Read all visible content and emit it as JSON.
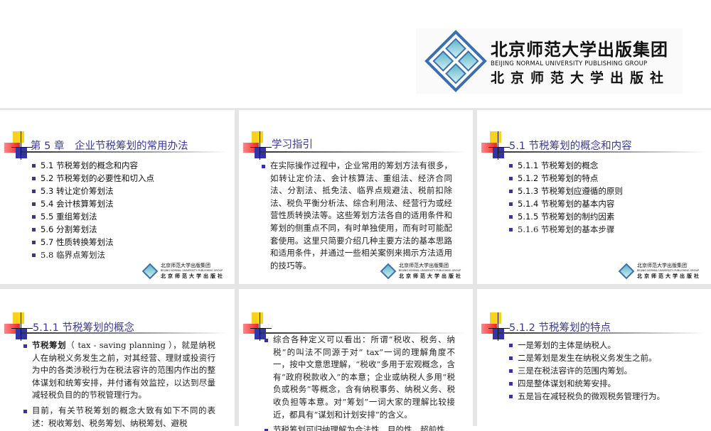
{
  "logo": {
    "cn": "北京师范大学出版集团",
    "en": "BEIJING NORMAL UNIVERSITY PUBLISHING GROUP",
    "cn2": "北京师范大学出版社"
  },
  "slides": [
    {
      "title": "第 5 章　企业节税筹划的常用办法",
      "items": [
        "5.1  节税筹划的概念和内容",
        "5.2  节税筹划的必要性和切入点",
        "5.3  转让定价筹划法",
        "5.4  会计核算筹划法",
        "5.5  重组筹划法",
        "5.6  分割筹划法",
        "5.7  性质转换筹划法",
        "5.8  临界点筹划法"
      ]
    },
    {
      "title": "学习指引",
      "items": [
        "在实际操作过程中，企业常用的筹划方法有很多，如转让定价法、会计核算法、重组法、经济合同法、分割法、抵免法、临界点规避法、税前扣除法、税负平衡分析法、综合利用法、经营行为或经营性质转换法等。这些筹划方法各自的适用条件和筹划的侧重点不同，有时单独使用，而有时可能配套使用。这里只简要介绍几种主要方法的基本思路和适用条件，并通过一些相关案例来揭示方法适用的技巧等。"
      ]
    },
    {
      "title": "5.1  节税筹划的概念和内容",
      "items": [
        "5.1.1  节税筹划的概念",
        "5.1.2  节税筹划的特点",
        "5.1.3  节税筹划应遵循的原则",
        "5.1.4  节税筹划的基本内容",
        "5.1.5  节税筹划的制约因素",
        "5.1.6  节税筹划的基本步骤"
      ]
    },
    {
      "title": "5.1.1  节税筹划的概念",
      "bold": "节税筹划",
      "items": [
        "（ tax - saving  planning ），就是纳税人在纳税义务发生之前，对其经营、理财或投资行为中的各类涉税行为在税法容许的范围内作出的整体谋划和统筹安排，并付诸有效监控，以达到尽量减轻税负目的的节税管理行为。",
        "目前，有关节税筹划的概念大致有如下不同的表述：税收筹划、税务筹划、纳税筹划、避税"
      ]
    },
    {
      "title": "",
      "items": [
        "综合各种定义可以看出：所谓“税收、税务、纳税”的叫法不同源于对“ tax”一词的理解角度不一，按中文意思理解，“税收”多用于宏观概念，含有“政府税款收入”的本意；企业或纳税人多用“税负或税务”等概念，含有纳税事务、纳税义务、税收负担等本意。对“筹划”一词大家的理解比较接近，都具有“谋划和计划安排”的含义。",
        "节税筹划可归纳理解为合法性、目的性、超前性"
      ]
    },
    {
      "title": "5.1.2  节税筹划的特点",
      "items": [
        "一是筹划的主体是纳税人。",
        "二是筹划是发生在纳税义务发生之前。",
        "三是在税法容许的范围内筹划。",
        "四是整体谋划和统筹安排。",
        "五是旨在减轻税负的微观税务管理行为。"
      ]
    }
  ]
}
